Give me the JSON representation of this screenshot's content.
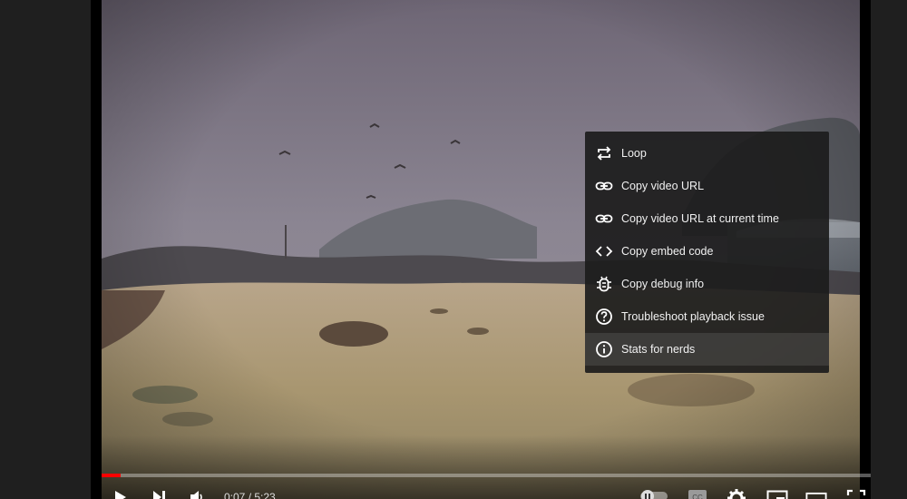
{
  "player": {
    "time_current": "0:07",
    "time_separator": " / ",
    "time_total": "5:23",
    "progress_fraction": 0.024
  },
  "menu": {
    "items": [
      {
        "label": "Loop",
        "icon": "loop-icon"
      },
      {
        "label": "Copy video URL",
        "icon": "link-icon"
      },
      {
        "label": "Copy video URL at current time",
        "icon": "link-icon"
      },
      {
        "label": "Copy embed code",
        "icon": "embed-code-icon"
      },
      {
        "label": "Copy debug info",
        "icon": "debug-icon"
      },
      {
        "label": "Troubleshoot playback issue",
        "icon": "help-icon"
      },
      {
        "label": "Stats for nerds",
        "icon": "info-icon"
      }
    ]
  },
  "colors": {
    "progress_played": "#ff0000",
    "menu_background": "#1c1c1c"
  }
}
